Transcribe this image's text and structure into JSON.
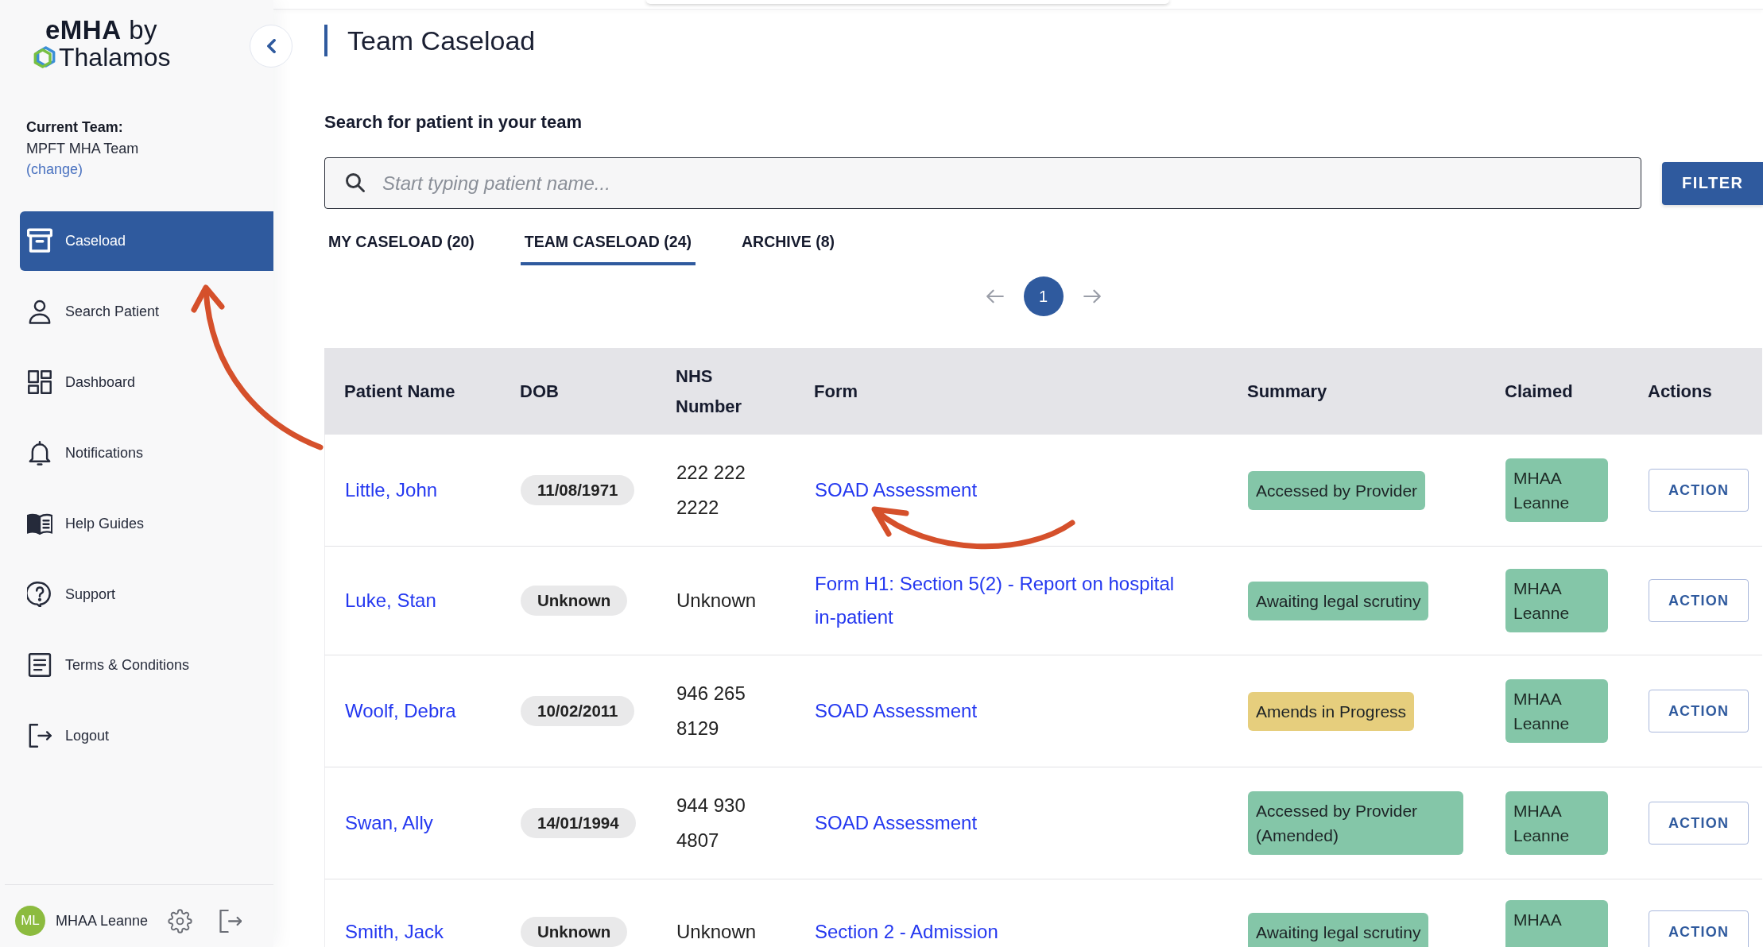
{
  "logo": {
    "title": "**eMHA** by",
    "brand": "Thalamos"
  },
  "sidebar": {
    "team_label": "Current Team:",
    "team_name": "MPFT MHA Team",
    "change_link": "(change)",
    "items": [
      {
        "label": "Caseload",
        "selected": true
      },
      {
        "label": "Search Patient",
        "selected": false
      },
      {
        "label": "Dashboard",
        "selected": false
      },
      {
        "label": "Notifications",
        "selected": false
      },
      {
        "label": "Help Guides",
        "selected": false
      },
      {
        "label": "Support",
        "selected": false
      },
      {
        "label": "Terms & Conditions",
        "selected": false
      },
      {
        "label": "Logout",
        "selected": false
      }
    ]
  },
  "user": {
    "initials": "ML",
    "name": "MHAA Leanne"
  },
  "page": {
    "title": "Team Caseload"
  },
  "search": {
    "label": "Search for patient in your team",
    "placeholder": "Start typing patient name...",
    "filter_button": "FILTER"
  },
  "tabs": [
    {
      "label": "MY CASELOAD (20)",
      "selected": false
    },
    {
      "label": "TEAM CASELOAD (24)",
      "selected": true
    },
    {
      "label": "ARCHIVE (8)",
      "selected": false
    }
  ],
  "pagination": {
    "pages": [
      {
        "label": "1",
        "selected": true
      }
    ]
  },
  "table": {
    "columns": [
      "Patient Name",
      "DOB",
      "NHS Number",
      "Form",
      "Summary",
      "Claimed",
      "Actions"
    ],
    "rows": [
      {
        "patient_name": "Little, John",
        "dob": "11/08/1971",
        "nhs_number": "222 222 2222",
        "form": "SOAD Assessment",
        "summary": {
          "label": "Accessed by Provider",
          "color": "#84c6a8"
        },
        "claimed": "MHAA Leanne",
        "action": "ACTION"
      },
      {
        "patient_name": "Luke, Stan",
        "dob": "Unknown",
        "nhs_number": "Unknown",
        "form": "Form H1: Section 5(2) - Report on hospital in-patient",
        "summary": {
          "label": "Awaiting legal scrutiny",
          "color": "#84c6a8"
        },
        "claimed": "MHAA Leanne",
        "action": "ACTION"
      },
      {
        "patient_name": "Woolf, Debra",
        "dob": "10/02/2011",
        "nhs_number": "946 265 8129",
        "form": "SOAD Assessment",
        "summary": {
          "label": "Amends in Progress",
          "color": "#e6ce7d"
        },
        "claimed": "MHAA Leanne",
        "action": "ACTION"
      },
      {
        "patient_name": "Swan, Ally",
        "dob": "14/01/1994",
        "nhs_number": "944 930 4807",
        "form": "SOAD Assessment",
        "summary": {
          "label": "Accessed by Provider (Amended)",
          "color": "#84c6a8"
        },
        "claimed": "MHAA Leanne",
        "action": "ACTION"
      },
      {
        "patient_name": "Smith, Jack",
        "dob": "Unknown",
        "nhs_number": "Unknown",
        "form": "Section 2 - Admission",
        "summary": {
          "label": "Awaiting legal scrutiny",
          "color": "#84c6a8"
        },
        "claimed": "MHAA",
        "action": "ACTION"
      }
    ]
  }
}
